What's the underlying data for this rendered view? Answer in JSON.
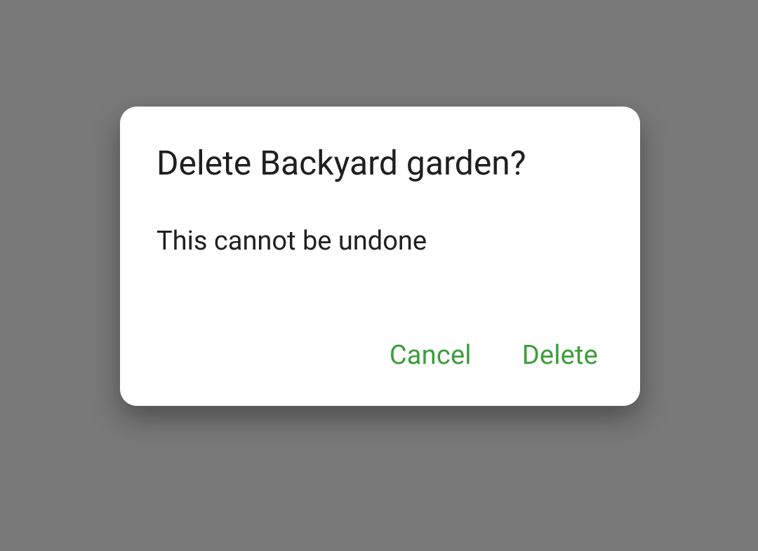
{
  "dialog": {
    "title": "Delete Backyard garden?",
    "message": "This cannot be undone",
    "actions": {
      "cancel": "Cancel",
      "delete": "Delete"
    }
  },
  "colors": {
    "accent": "#3b9e3b",
    "scrim": "#797979",
    "surface": "#ffffff",
    "text_primary": "#1f1f1f"
  }
}
